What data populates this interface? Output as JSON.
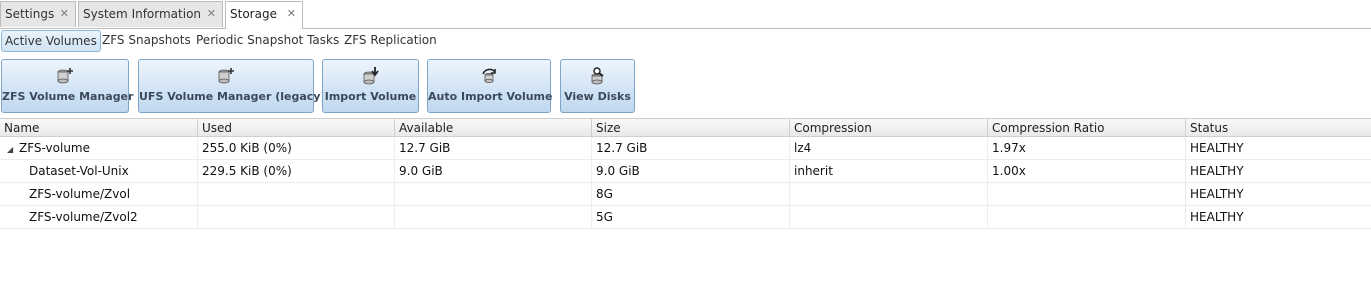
{
  "tabs": [
    {
      "label": "Settings",
      "close": "✕"
    },
    {
      "label": "System Information",
      "close": "✕"
    },
    {
      "label": "Storage",
      "close": "✕"
    }
  ],
  "subtabs": [
    "Active Volumes",
    "ZFS Snapshots",
    "Periodic Snapshot Tasks",
    "ZFS Replication"
  ],
  "toolbar": [
    {
      "label": "ZFS Volume Manager",
      "icon": "volume-add-icon"
    },
    {
      "label": "UFS Volume Manager (legacy)",
      "icon": "volume-add-icon"
    },
    {
      "label": "Import Volume",
      "icon": "import-icon"
    },
    {
      "label": "Auto Import Volume",
      "icon": "auto-import-icon"
    },
    {
      "label": "View Disks",
      "icon": "view-disks-icon"
    }
  ],
  "grid": {
    "columns": [
      "Name",
      "Used",
      "Available",
      "Size",
      "Compression",
      "Compression Ratio",
      "Status"
    ],
    "rows": [
      {
        "expander": "◢",
        "name": "ZFS-volume",
        "used": "255.0 KiB (0%)",
        "available": "12.7 GiB",
        "size": "12.7 GiB",
        "compression": "lz4",
        "ratio": "1.97x",
        "status": "HEALTHY"
      },
      {
        "name": "Dataset-Vol-Unix",
        "used": "229.5 KiB (0%)",
        "available": "9.0 GiB",
        "size": "9.0 GiB",
        "compression": "inherit",
        "ratio": "1.00x",
        "status": "HEALTHY"
      },
      {
        "name": "ZFS-volume/Zvol",
        "used": "",
        "available": "",
        "size": "8G",
        "compression": "",
        "ratio": "",
        "status": "HEALTHY"
      },
      {
        "name": "ZFS-volume/Zvol2",
        "used": "",
        "available": "",
        "size": "5G",
        "compression": "",
        "ratio": "",
        "status": "HEALTHY"
      }
    ]
  }
}
